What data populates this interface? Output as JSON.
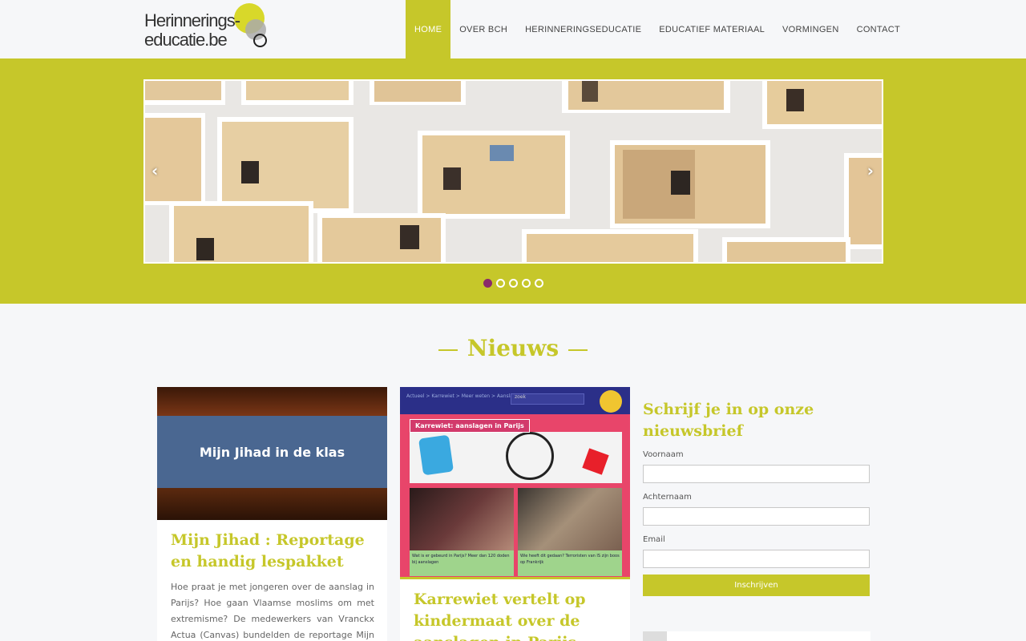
{
  "header": {
    "logo_line1": "Herinnerings-",
    "logo_line2": "educatie.be",
    "nav": [
      {
        "label": "HOME",
        "active": true
      },
      {
        "label": "OVER BCH",
        "active": false
      },
      {
        "label": "HERINNERINGSEDUCATIE",
        "active": false
      },
      {
        "label": "EDUCATIEF MATERIAAL",
        "active": false
      },
      {
        "label": "VORMINGEN",
        "active": false
      },
      {
        "label": "CONTACT",
        "active": false
      }
    ]
  },
  "slider": {
    "prev_icon": "chevron-left-icon",
    "next_icon": "chevron-right-icon",
    "prev_glyph": "‹",
    "next_glyph": "›",
    "dot_count": 5,
    "active_dot": 0
  },
  "news": {
    "title": "Nieuws",
    "cards": [
      {
        "image_text": "Mijn Jihad in de klas",
        "title": "Mijn Jihad : Reportage en handig lespakket",
        "text": "Hoe praat je met jongeren over de aanslag in Parijs? Hoe gaan Vlaamse moslims om met extremisme? De medewerkers van Vranckx Actua (Canvas) bundelden de reportage Mijn Jihad in een"
      },
      {
        "image_crumb": "Actueel > Karrewiet > Meer weten > Aanslagen in Parijs",
        "image_search": "zoek",
        "image_label": "Karrewiet: aanslagen in Parijs",
        "image_cap1": "Wat is er gebeurd in Parijs? Meer dan 120 doden bij aanslagen",
        "image_cap2": "Wie heeft dit gedaan? Terroristen van IS zijn boos op Frankrijk",
        "title": "Karrewiet vertelt op kindermaat over de aanslagen in Parijs"
      }
    ]
  },
  "newsletter": {
    "title": "Schrijf je in op onze nieuwsbrief",
    "fields": [
      {
        "label": "Voornaam",
        "value": ""
      },
      {
        "label": "Achternaam",
        "value": ""
      },
      {
        "label": "Email",
        "value": ""
      }
    ],
    "submit_label": "Inschrijven"
  },
  "colors": {
    "accent": "#c6c72a",
    "active_dot": "#8a2a6a",
    "background": "#f6f7f9"
  }
}
